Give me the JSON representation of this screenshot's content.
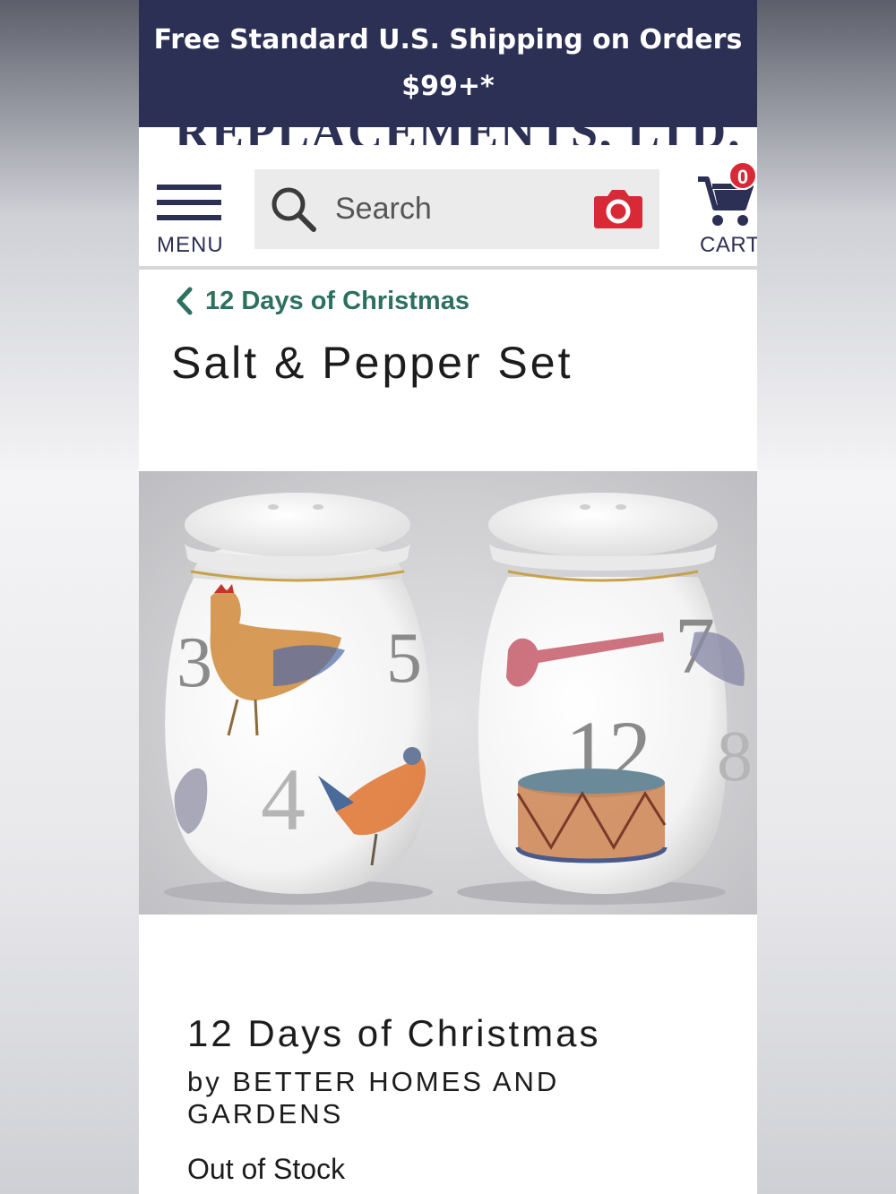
{
  "promo": {
    "line1": "Free Standard U.S. Shipping on Orders",
    "line2": "$99+*"
  },
  "header": {
    "logo_text": "REPLACEMENTS, LTD.",
    "menu_label": "MENU",
    "cart_label": "CART",
    "cart_count": "0",
    "search": {
      "placeholder": "Search"
    }
  },
  "breadcrumb": {
    "label": "12 Days of Christmas"
  },
  "page_title": "Salt & Pepper Set",
  "product": {
    "pattern": "12 Days of Christmas",
    "by_line": "by BETTER HOMES AND GARDENS",
    "stock_status": "Out of Stock",
    "image_numbers": {
      "left": [
        "3",
        "4",
        "5"
      ],
      "right": [
        "7",
        "8",
        "12"
      ]
    }
  },
  "colors": {
    "brand_navy": "#2d3055",
    "breadcrumb_green": "#2e7060",
    "camera_red": "#d72a36",
    "badge_red": "#d72a36"
  },
  "icons": {
    "menu": "hamburger-icon",
    "search": "magnifier-icon",
    "camera": "camera-icon",
    "cart": "shopping-cart-icon",
    "back": "chevron-left-icon"
  }
}
